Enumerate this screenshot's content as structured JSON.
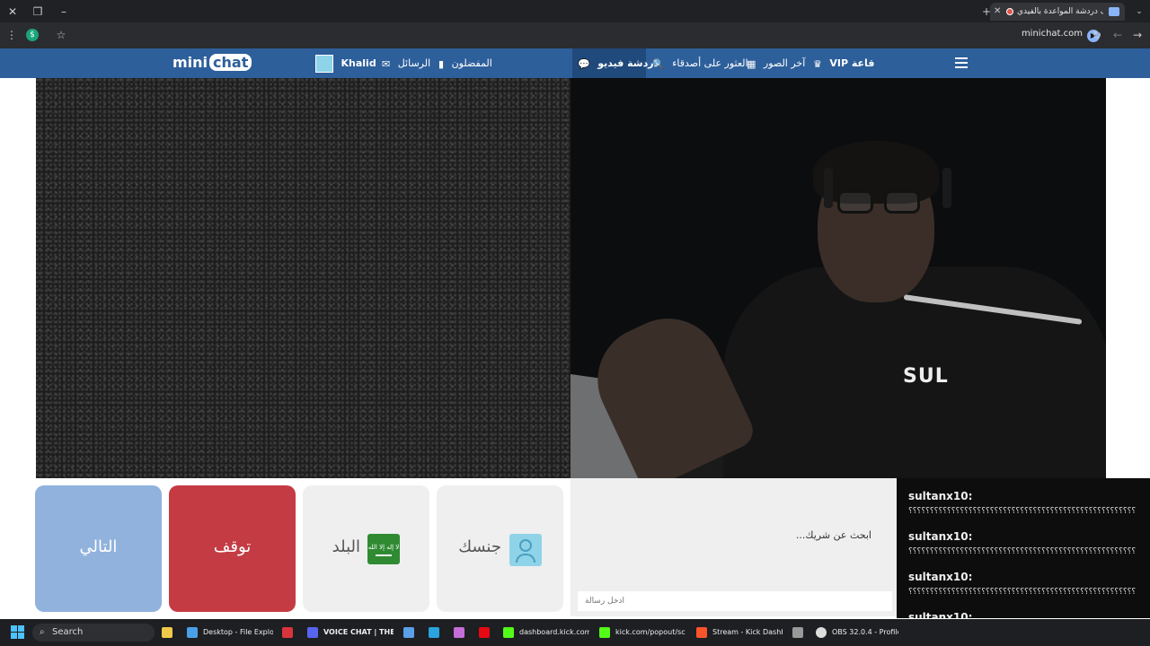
{
  "browser": {
    "tab_title": "غرف دردشة المواعدة بالفيدي",
    "url": "minichat.com"
  },
  "site": {
    "logo_prefix": "mini",
    "logo_suffix": "chat",
    "nav": {
      "user_name": "Khalid",
      "messages": "الرسائل",
      "favorites": "المفضلون",
      "video_chat": "دردشة فيديو",
      "find_friends": "العثور على أصدقاء",
      "latest_photos": "آخر الصور",
      "vip_room": "VIP قاعة"
    }
  },
  "controls": {
    "next_label": "التالي",
    "stop_label": "توقف",
    "country_label": "البلد",
    "flag_text": "لا إله إلا الله",
    "gender_label": "جنسك"
  },
  "chat": {
    "status_text": "...ابحث عن شريك",
    "input_placeholder": "أدخل رسالة"
  },
  "overlay_chat": {
    "messages": [
      {
        "user": "sultanx10:",
        "text": "؟؟؟؟؟؟؟؟؟؟؟؟؟؟؟؟؟؟؟؟؟؟؟؟؟؟؟؟؟؟؟؟؟؟؟؟؟؟؟؟؟؟؟؟؟؟؟؟؟؟؟؟؟"
      },
      {
        "user": "sultanx10:",
        "text": "؟؟؟؟؟؟؟؟؟؟؟؟؟؟؟؟؟؟؟؟؟؟؟؟؟؟؟؟؟؟؟؟؟؟؟؟؟؟؟؟؟؟؟؟؟؟؟؟؟؟؟؟؟"
      },
      {
        "user": "sultanx10:",
        "text": "؟؟؟؟؟؟؟؟؟؟؟؟؟؟؟؟؟؟؟؟؟؟؟؟؟؟؟؟؟؟؟؟؟؟؟؟؟؟؟؟؟؟؟؟؟؟؟؟؟؟؟؟؟"
      },
      {
        "user": "sultanx10:",
        "text": "؟؟؟؟؟؟؟؟؟؟؟؟؟؟؟؟؟؟؟؟؟؟؟؟؟؟؟؟؟؟؟؟؟؟؟؟؟؟؟؟؟؟؟؟؟؟؟؟؟؟؟؟؟"
      }
    ]
  },
  "webcam": {
    "shirt_text": "SUL"
  },
  "taskbar": {
    "search_label": "Search",
    "apps": [
      {
        "label": "Desktop - File Explore",
        "icon": "folder-icon",
        "color": "#4aa0e6"
      },
      {
        "label": "",
        "icon": "app-icon",
        "color": "#d9343b"
      },
      {
        "label": "VOICE CHAT | THE BO",
        "icon": "discord-icon",
        "color": "#5865f2"
      },
      {
        "label": "",
        "icon": "photos-icon",
        "color": "#5aa0e8"
      },
      {
        "label": "",
        "icon": "telegram-icon",
        "color": "#2aa3de"
      },
      {
        "label": "",
        "icon": "copilot-icon",
        "color": "#c56ed9"
      },
      {
        "label": "",
        "icon": "netflix-icon",
        "color": "#e50914"
      },
      {
        "label": "dashboard.kick.com/p",
        "icon": "kick-icon",
        "color": "#53fc18"
      },
      {
        "label": "kick.com/popout/scan",
        "icon": "kick-icon",
        "color": "#53fc18"
      },
      {
        "label": "Stream - Kick Dashbo",
        "icon": "brave-icon",
        "color": "#fb542b"
      },
      {
        "label": "",
        "icon": "app-icon",
        "color": "#999999"
      },
      {
        "label": "OBS 32.0.4 - Profile:",
        "icon": "obs-icon",
        "color": "#dddddd"
      }
    ]
  }
}
